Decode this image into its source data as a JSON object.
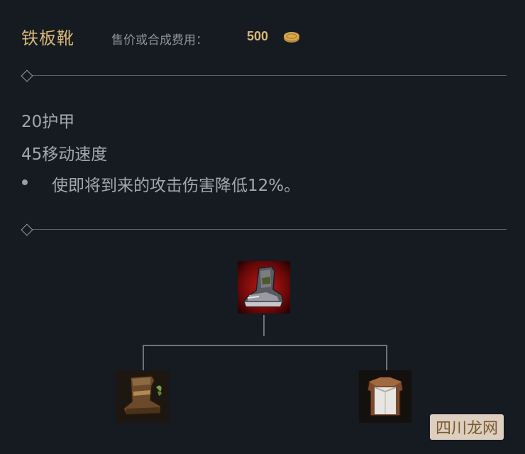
{
  "item": {
    "title": "铁板靴",
    "cost_label": "售价或合成费用：",
    "cost_value": "500",
    "cost_icon": "gold-coin-icon"
  },
  "stats": [
    "20护甲",
    "45移动速度"
  ],
  "passive": "使即将到来的攻击伤害降低12%。",
  "build_tree": {
    "result": {
      "name": "plated-steelcaps-icon"
    },
    "components": [
      {
        "name": "boots-icon"
      },
      {
        "name": "cloth-armor-icon"
      }
    ]
  },
  "watermark": "四川龙网",
  "colors": {
    "background": "#161a21",
    "title_gold": "#d8b878",
    "text": "#a3a8ae",
    "divider": "#5c6168"
  }
}
